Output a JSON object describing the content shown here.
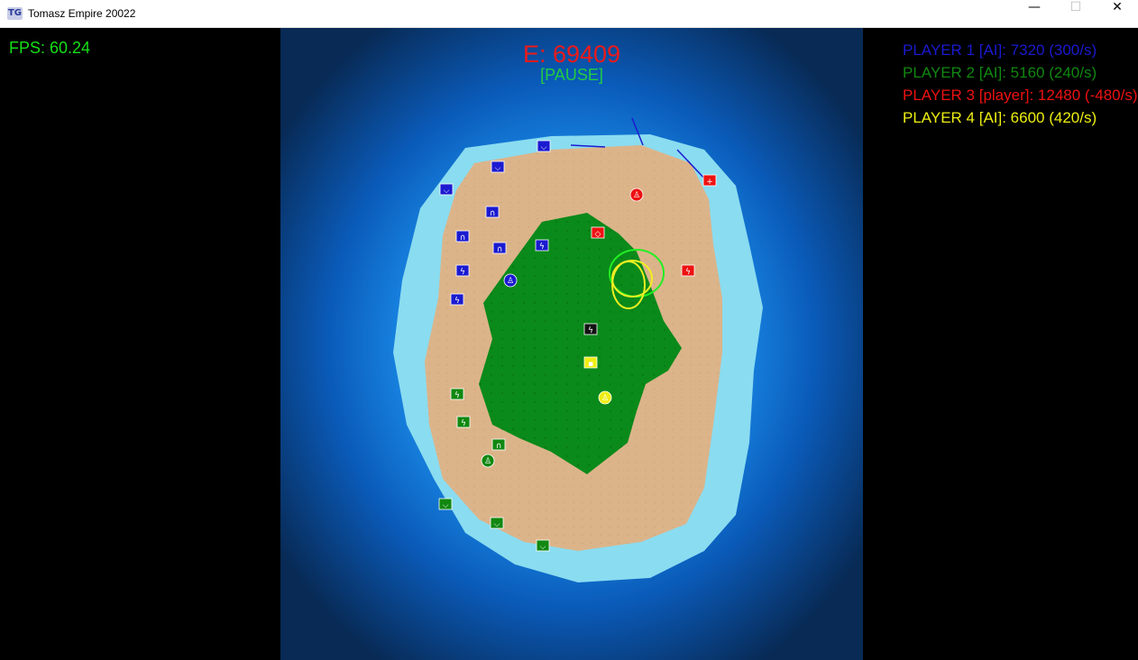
{
  "window": {
    "icon_text": "TG",
    "title": "Tomasz Empire 20022",
    "min_glyph": "—",
    "max_glyph": "☐",
    "close_glyph": "✕"
  },
  "hud": {
    "fps": "FPS: 60.24",
    "energy": "E: 69409",
    "status": "[PAUSE]"
  },
  "players": [
    {
      "label": "PLAYER 1 [AI]: 7320 (300/s)",
      "color": "#1a1ad0"
    },
    {
      "label": "PLAYER 2 [AI]: 5160 (240/s)",
      "color": "#118811"
    },
    {
      "label": "PLAYER 3 [player]: 12480 (-480/s)",
      "color": "#ee1111"
    },
    {
      "label": "PLAYER 4 [AI]: 6600 (420/s)",
      "color": "#eeee11"
    }
  ],
  "colors": {
    "ocean_deep": "#082a55",
    "ocean_mid": "#0a6ad0",
    "shallow": "#8adcf0",
    "sand": "#dcb48a",
    "grass": "#0a8a1a",
    "p1": "#1a1ad0",
    "p2": "#118811",
    "p3": "#ee1111",
    "p4": "#eeee11",
    "neutral": "#111111"
  },
  "units": [
    {
      "owner": "p1",
      "kind": "building",
      "icon": "ship-icon"
    },
    {
      "owner": "p1",
      "kind": "building",
      "icon": "ship-icon"
    },
    {
      "owner": "p1",
      "kind": "building",
      "icon": "ship-icon"
    },
    {
      "owner": "p1",
      "kind": "building",
      "icon": "dome-icon"
    },
    {
      "owner": "p1",
      "kind": "building",
      "icon": "dome-icon"
    },
    {
      "owner": "p1",
      "kind": "building",
      "icon": "dome-icon"
    },
    {
      "owner": "p1",
      "kind": "building",
      "icon": "lightning-icon"
    },
    {
      "owner": "p1",
      "kind": "building",
      "icon": "lightning-icon"
    },
    {
      "owner": "p1",
      "kind": "building",
      "icon": "lightning-icon"
    },
    {
      "owner": "p1",
      "kind": "soldier",
      "icon": "soldier-icon"
    },
    {
      "owner": "p2",
      "kind": "building",
      "icon": "lightning-icon"
    },
    {
      "owner": "p2",
      "kind": "building",
      "icon": "lightning-icon"
    },
    {
      "owner": "p2",
      "kind": "building",
      "icon": "dome-icon"
    },
    {
      "owner": "p2",
      "kind": "building",
      "icon": "ship-icon"
    },
    {
      "owner": "p2",
      "kind": "building",
      "icon": "ship-icon"
    },
    {
      "owner": "p2",
      "kind": "building",
      "icon": "ship-icon"
    },
    {
      "owner": "p2",
      "kind": "soldier",
      "icon": "soldier-icon"
    },
    {
      "owner": "p3",
      "kind": "building",
      "icon": "lightning-icon"
    },
    {
      "owner": "p3",
      "kind": "building",
      "icon": "medic-icon"
    },
    {
      "owner": "p3",
      "kind": "building",
      "icon": "shield-icon"
    },
    {
      "owner": "p3",
      "kind": "soldier",
      "icon": "soldier-icon"
    },
    {
      "owner": "p4",
      "kind": "building",
      "icon": "flag-icon"
    },
    {
      "owner": "p4",
      "kind": "soldier",
      "icon": "soldier-icon"
    },
    {
      "owner": "neutral",
      "kind": "building",
      "icon": "lightning-icon"
    }
  ]
}
